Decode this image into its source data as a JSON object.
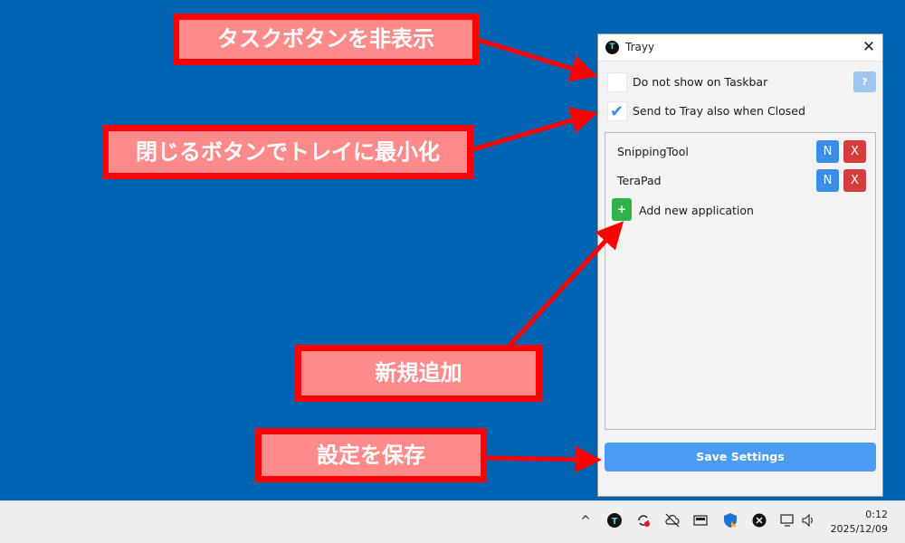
{
  "window": {
    "title": "Trayy",
    "icon_letter": "T",
    "close_glyph": "✕",
    "options": [
      {
        "label": "Do not show on Taskbar",
        "checked": false
      },
      {
        "label": "Send to Tray also when Closed",
        "checked": true
      }
    ],
    "help_label": "?",
    "apps": [
      {
        "name": "SnippingTool",
        "n_label": "N",
        "x_label": "X"
      },
      {
        "name": "TeraPad",
        "n_label": "N",
        "x_label": "X"
      }
    ],
    "add_label": "Add new application",
    "add_glyph": "+",
    "save_label": "Save Settings"
  },
  "callouts": {
    "hide_task_button": "タスクボタンを非表示",
    "minimize_to_tray": "閉じるボタンでトレイに最小化",
    "add_new": "新規追加",
    "save_settings": "設定を保存"
  },
  "taskbar": {
    "time": "0:12",
    "date": "2025/12/09"
  },
  "colors": {
    "desktop": "#0063b1",
    "callout_border": "#ff0000",
    "callout_fill": "#ff8a8a",
    "n_button": "#3b8ee8",
    "x_button": "#d43d3d",
    "add_button": "#2fb24a",
    "save_button": "#4a9cf0"
  }
}
